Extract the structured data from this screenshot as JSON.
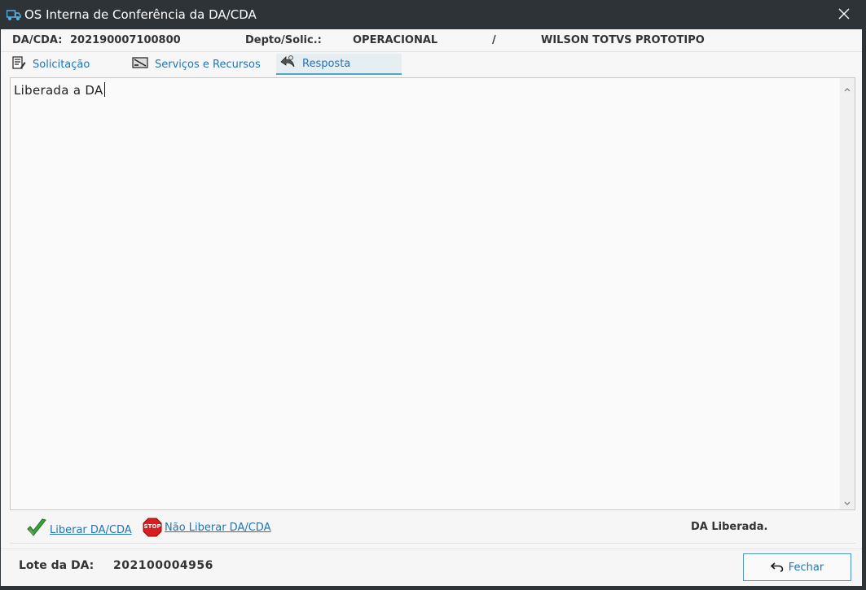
{
  "window": {
    "title": "OS Interna de Conferência da DA/CDA",
    "title_icon": "truck-icon",
    "close_icon": "close-icon"
  },
  "header": {
    "dacda_label": "DA/CDA:",
    "dacda_value": "202190007100800",
    "depto_label": "Depto/Solic.:",
    "depto_value": "OPERACIONAL",
    "separator": "/",
    "solicitante": "WILSON TOTVS PROTOTIPO"
  },
  "tabs": [
    {
      "label": "Solicitação",
      "icon": "document-edit-icon",
      "active": false
    },
    {
      "label": "Serviços e Recursos",
      "icon": "services-icon",
      "active": false
    },
    {
      "label": "Resposta",
      "icon": "reply-icon",
      "active": true
    }
  ],
  "editor": {
    "value": "Liberada a DA"
  },
  "actions": {
    "liberar_label": "Liberar DA/CDA",
    "liberar_icon": "checkmark-icon",
    "nao_liberar_label": "Não Liberar DA/CDA",
    "nao_liberar_icon": "stop-sign-icon",
    "stop_text": "STOP",
    "status": "DA Liberada."
  },
  "footer": {
    "lote_label": "Lote da DA:",
    "lote_value": "202100004956",
    "fechar_label": "Fechar",
    "fechar_icon": "undo-icon"
  },
  "colors": {
    "accent": "#1f74b8",
    "tab_underline": "#4ba6c7",
    "titlebar": "#2e3337"
  }
}
